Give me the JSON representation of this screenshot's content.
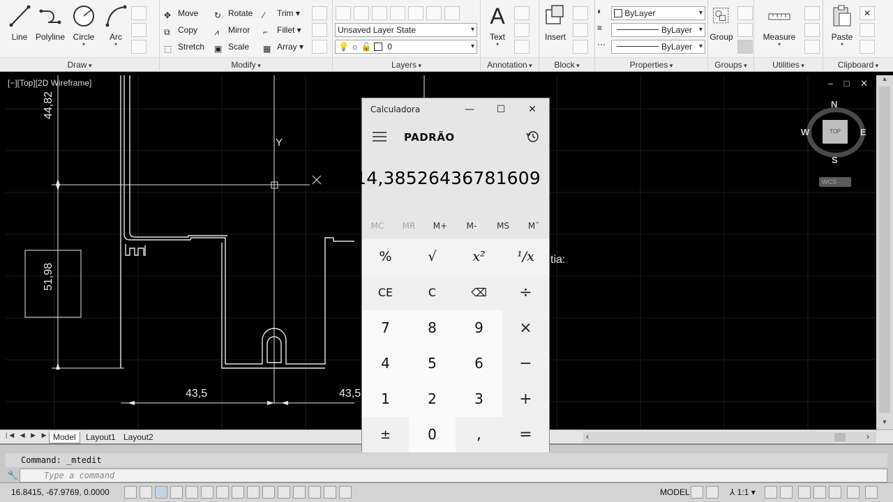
{
  "ribbon": {
    "draw": {
      "title": "Draw",
      "line": "Line",
      "polyline": "Polyline",
      "circle": "Circle",
      "arc": "Arc"
    },
    "modify": {
      "title": "Modify",
      "move": "Move",
      "rotate": "Rotate",
      "trim": "Trim",
      "copy": "Copy",
      "mirror": "Mirror",
      "fillet": "Fillet",
      "stretch": "Stretch",
      "scale": "Scale",
      "array": "Array"
    },
    "layers": {
      "title": "Layers",
      "layer_state": "Unsaved Layer State",
      "current_layer": "0"
    },
    "annotation": {
      "title": "Annotation",
      "text": "Text"
    },
    "block": {
      "title": "Block",
      "insert": "Insert"
    },
    "properties": {
      "title": "Properties",
      "color": "ByLayer",
      "linetype": "ByLayer",
      "lineweight": "ByLayer"
    },
    "groups": {
      "title": "Groups",
      "group": "Group"
    },
    "utilities": {
      "title": "Utilities",
      "measure": "Measure"
    },
    "clipboard": {
      "title": "Clipboard",
      "paste": "Paste"
    }
  },
  "viewport": {
    "label": "[−][Top][2D Wireframe]",
    "controls": "– □ ✕"
  },
  "drawing": {
    "dims": {
      "d1": "44,82",
      "d2": "51,98",
      "d3": "43,5",
      "d4": "43,5"
    },
    "axis_y": "Y",
    "partial_text": "tia:",
    "viewcube": {
      "n": "N",
      "s": "S",
      "e": "E",
      "w": "W",
      "top": "TOP",
      "wcs": "WCS"
    }
  },
  "layout_tabs": [
    "Model",
    "Layout1",
    "Layout2"
  ],
  "command": {
    "history": "Command: _mtedit",
    "placeholder": "Type a command"
  },
  "status": {
    "coords": "16.8415, -67.9769, 0.0000",
    "model": "MODEL",
    "scale": "1:1"
  },
  "calculator": {
    "title": "Calculadora",
    "mode": "PADRÃO",
    "display": "14,38526436781609",
    "memory": [
      "MC",
      "MR",
      "M+",
      "M-",
      "MS",
      "Mˇ"
    ],
    "keys": [
      [
        "%",
        "√",
        "x²",
        "¹/x"
      ],
      [
        "CE",
        "C",
        "⌫",
        "÷"
      ],
      [
        "7",
        "8",
        "9",
        "×"
      ],
      [
        "4",
        "5",
        "6",
        "−"
      ],
      [
        "1",
        "2",
        "3",
        "+"
      ],
      [
        "±",
        "0",
        ",",
        "="
      ]
    ]
  },
  "colors": {
    "ribbon_bg": "#f4f4f4",
    "drawing_bg": "#000000",
    "calc_bg": "#e6e6e6"
  }
}
